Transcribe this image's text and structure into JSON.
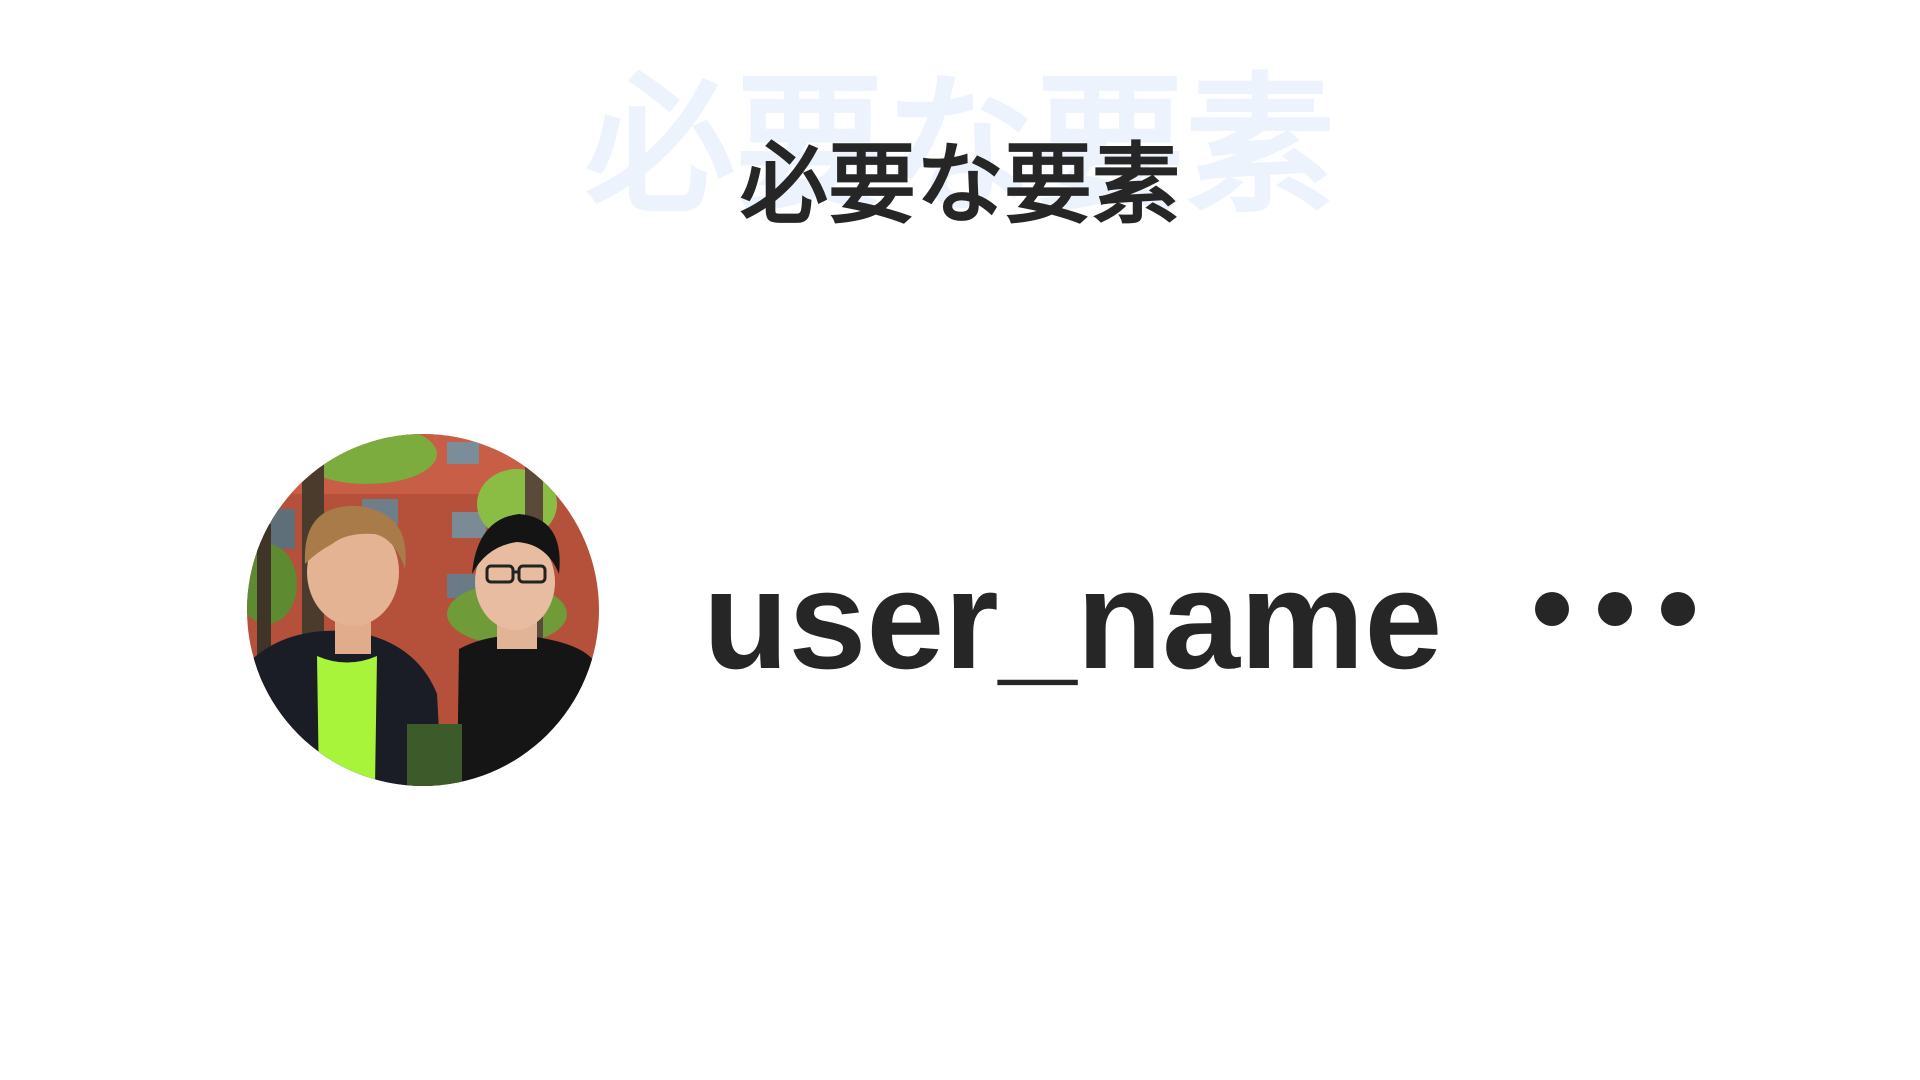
{
  "slide": {
    "watermark_text": "必要な要素",
    "title": "必要な要素"
  },
  "profile_row": {
    "avatar_description_icon": "avatar-photo-icon",
    "username": "user_name",
    "more_icon": "more-horizontal-icon"
  },
  "colors": {
    "text": "#262626",
    "watermark": "#edf3fd",
    "background": "#ffffff"
  }
}
